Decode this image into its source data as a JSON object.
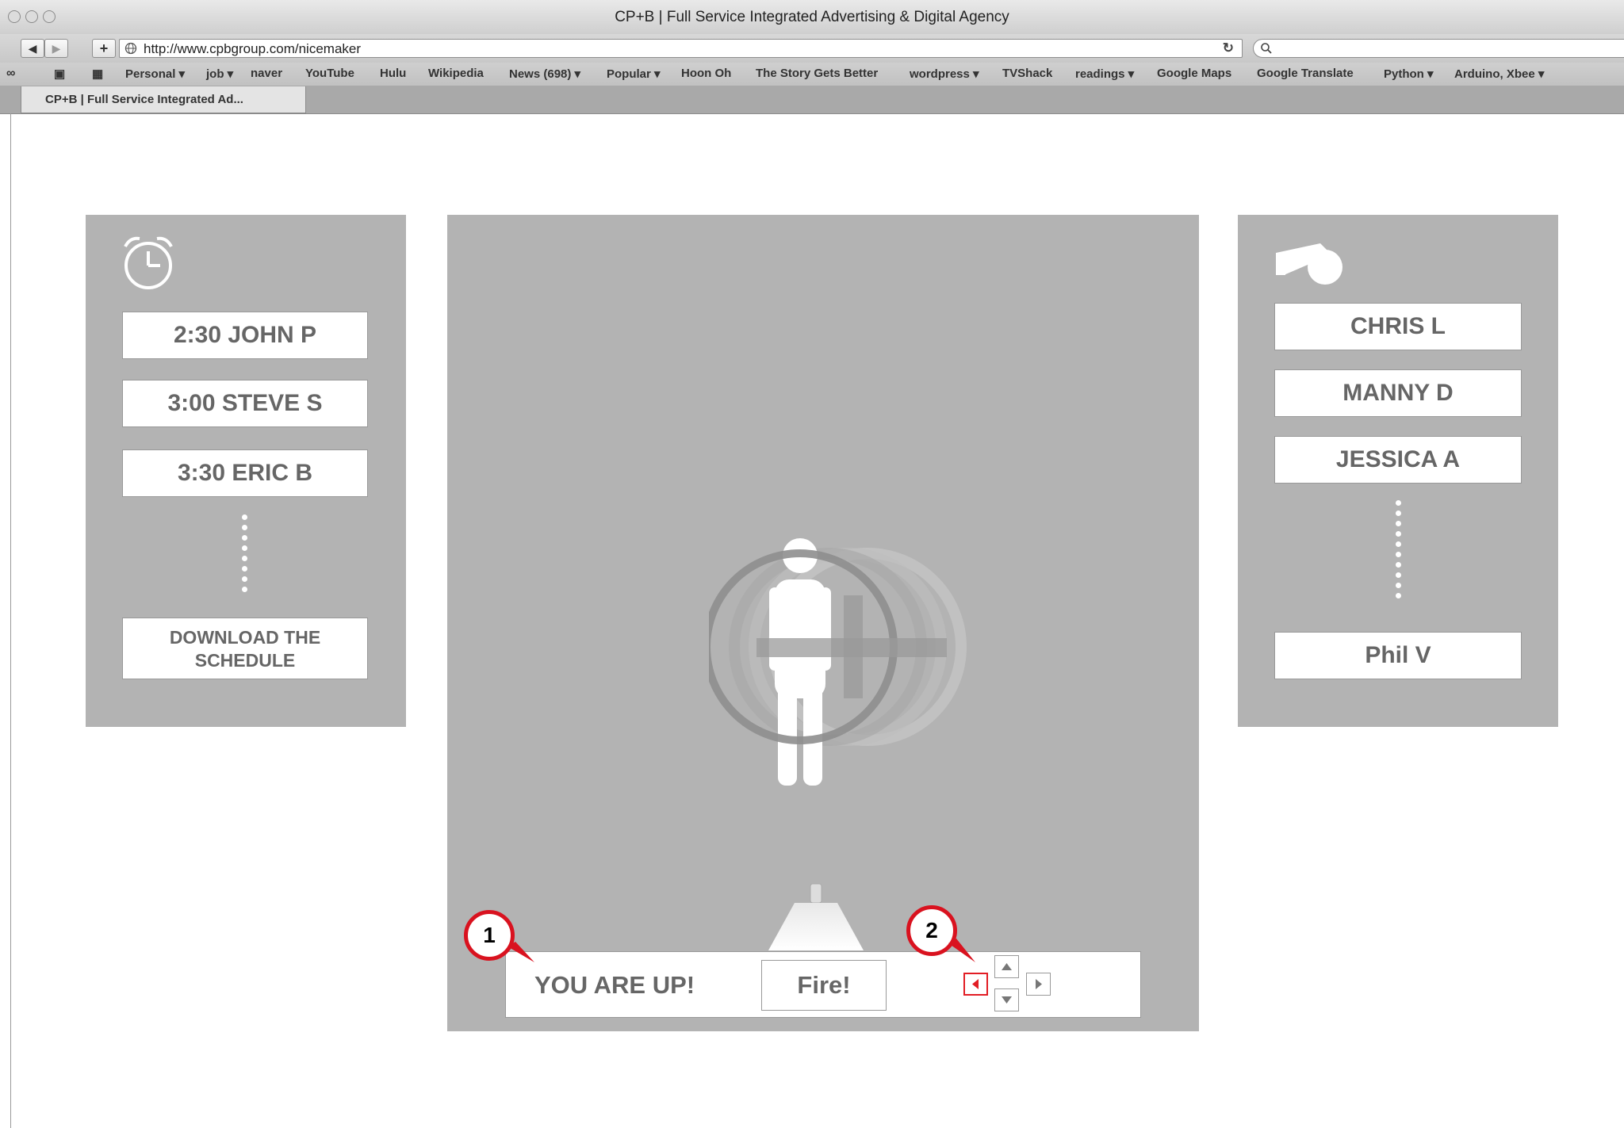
{
  "window": {
    "title": "CP+B | Full Service Integrated Advertising & Digital Agency"
  },
  "toolbar": {
    "back_icon": "back-arrow-icon",
    "forward_icon": "forward-arrow-icon",
    "add_icon": "plus-icon",
    "url": "http://www.cpbgroup.com/nicemaker",
    "reload_icon": "reload-icon",
    "search_icon": "search-icon"
  },
  "bookmarks": [
    "Personal ▾",
    "job ▾",
    "naver",
    "YouTube",
    "Hulu",
    "Wikipedia",
    "News (698) ▾",
    "Popular ▾",
    "Hoon Oh",
    "The Story Gets Better",
    "wordpress ▾",
    "TVShack",
    "readings ▾",
    "Google Maps",
    "Google Translate",
    "Python ▾",
    "Arduino, Xbee ▾"
  ],
  "tab": {
    "label": "CP+B | Full Service Integrated Ad..."
  },
  "schedule": {
    "icon": "alarm-clock-icon",
    "items": [
      "2:30 JOHN P",
      "3:00 STEVE S",
      "3:30 ERIC B"
    ],
    "download_label": "DOWNLOAD THE SCHEDULE"
  },
  "referees": {
    "icon": "whistle-icon",
    "items": [
      "CHRIS L",
      "MANNY D",
      "JESSICA A"
    ],
    "last_item": "Phil V"
  },
  "stage": {
    "status_text": "YOU ARE UP!",
    "fire_label": "Fire!",
    "figure_icon": "person-target-icon",
    "crosshair_icon": "crosshair-icon",
    "cannon_icon": "cannon-icon",
    "controls": {
      "left_icon": "arrow-left-icon",
      "up_icon": "arrow-up-icon",
      "down_icon": "arrow-down-icon",
      "right_icon": "arrow-right-icon"
    }
  },
  "annotations": [
    "1",
    "2"
  ],
  "colors": {
    "panel": "#b3b3b3",
    "callout_border": "#d9121f",
    "label_text": "#666666"
  }
}
